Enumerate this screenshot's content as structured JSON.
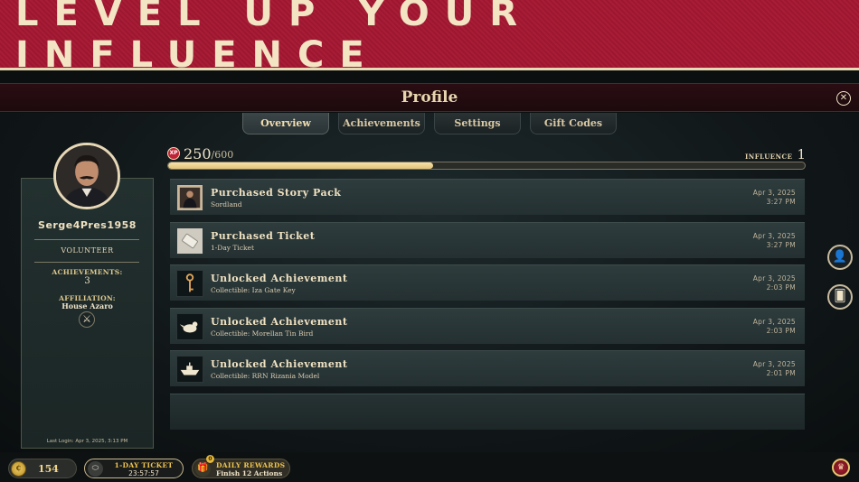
{
  "banner": {
    "title": "LEVEL UP YOUR INFLUENCE"
  },
  "profile": {
    "title": "Profile",
    "close_icon": "close-icon"
  },
  "tabs": [
    {
      "label": "Overview",
      "active": true
    },
    {
      "label": "Achievements",
      "active": false
    },
    {
      "label": "Settings",
      "active": false
    },
    {
      "label": "Gift Codes",
      "active": false
    }
  ],
  "user": {
    "username": "Serge4Pres1958",
    "rank": "VOLUNTEER",
    "achievements_label": "ACHIEVEMENTS:",
    "achievements_value": "3",
    "affiliation_label": "AFFILIATION:",
    "affiliation_value": "House Azaro",
    "last_login": "Last Login: Apr 3, 2025, 3:13 PM"
  },
  "xp": {
    "badge": "XP",
    "current": "250",
    "max": "/600",
    "progress_fraction": 0.4167,
    "influence_label": "INFLUENCE",
    "influence_value": "1"
  },
  "activity": [
    {
      "title": "Purchased Story Pack",
      "subtitle": "Sordland",
      "date": "Apr 3, 2025",
      "time": "3:27 PM",
      "icon": "portrait-icon"
    },
    {
      "title": "Purchased Ticket",
      "subtitle": "1-Day Ticket",
      "date": "Apr 3, 2025",
      "time": "3:27 PM",
      "icon": "ticket-icon"
    },
    {
      "title": "Unlocked Achievement",
      "subtitle": "Collectible: Iza Gate Key",
      "date": "Apr 3, 2025",
      "time": "2:03 PM",
      "icon": "key-icon"
    },
    {
      "title": "Unlocked Achievement",
      "subtitle": "Collectible: Morellan Tin Bird",
      "date": "Apr 3, 2025",
      "time": "2:03 PM",
      "icon": "bird-icon"
    },
    {
      "title": "Unlocked Achievement",
      "subtitle": "Collectible: RRN Rizania Model",
      "date": "Apr 3, 2025",
      "time": "2:01 PM",
      "icon": "ship-icon"
    }
  ],
  "bottom": {
    "coins": "154",
    "ticket_label": "1-DAY TICKET",
    "ticket_timer": "23:57:57",
    "rewards_label": "DAILY REWARDS",
    "rewards_sub": "Finish 12 Actions",
    "rewards_badge": "0"
  },
  "colors": {
    "accent_red": "#a81c36",
    "gold": "#e1c27a",
    "cream": "#efe3c8"
  }
}
